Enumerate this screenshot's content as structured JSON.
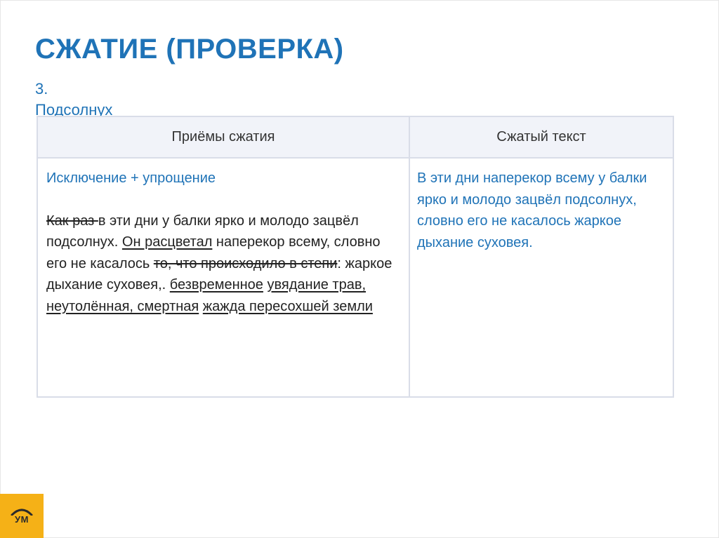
{
  "slide": {
    "title": "СЖАТИЕ (ПРОВЕРКА)",
    "subtitle_line1": "3.",
    "subtitle_line2": "Подсолнух"
  },
  "table": {
    "headers": {
      "techniques": "Приёмы сжатия",
      "compressed": "Сжатый текст"
    },
    "left_cell": {
      "technique": "Исключение + упрощение",
      "segments": [
        {
          "text": "Как раз ",
          "style": "strike"
        },
        {
          "text": "в эти дни у балки ярко и молодо зацвёл подсолнух. ",
          "style": "normal"
        },
        {
          "text": "Он расцветал",
          "style": "underline"
        },
        {
          "text": " наперекор всему, словно его не касалось ",
          "style": "normal"
        },
        {
          "text": "то, что происходило в степи",
          "style": "strike"
        },
        {
          "text": ": жаркое дыхание суховея,. ",
          "style": "normal"
        },
        {
          "text": "безвременное",
          "style": "underline"
        },
        {
          "text": " ",
          "style": "normal"
        },
        {
          "text": "увядание трав, неутолённая, смертная",
          "style": "underline"
        },
        {
          "text": " ",
          "style": "normal"
        },
        {
          "text": "жажда пересохшей земли",
          "style": "underline"
        }
      ]
    },
    "right_cell": {
      "text": "В эти дни наперекор всему у балки ярко и молодо зацвёл подсолнух, словно его не касалось жаркое дыхание суховея."
    }
  },
  "logo": {
    "text": "УМ"
  },
  "colors": {
    "accent": "#1f73b7",
    "table_border": "#d9dde8",
    "header_bg": "#f1f3f9",
    "logo_bg": "#f5b117"
  }
}
